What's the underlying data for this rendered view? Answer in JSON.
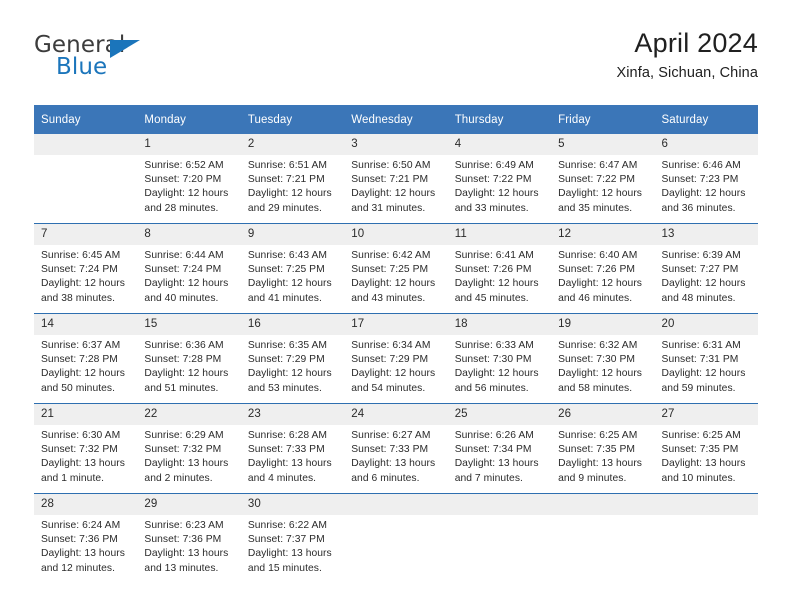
{
  "brand": {
    "name_part1": "General",
    "name_part2": "Blue"
  },
  "header": {
    "title": "April 2024",
    "subtitle": "Xinfa, Sichuan, China"
  },
  "weekday_headers": [
    "Sunday",
    "Monday",
    "Tuesday",
    "Wednesday",
    "Thursday",
    "Friday",
    "Saturday"
  ],
  "colors": {
    "header_blue": "#3b76b8",
    "row_divider_blue": "#2e6fb0",
    "daynum_background": "#efefef",
    "brand_blue": "#1b75bb"
  },
  "weeks": [
    [
      {
        "day": "",
        "empty": true,
        "sunrise": "",
        "sunset": "",
        "daylight1": "",
        "daylight2": ""
      },
      {
        "day": "1",
        "empty": false,
        "sunrise": "Sunrise: 6:52 AM",
        "sunset": "Sunset: 7:20 PM",
        "daylight1": "Daylight: 12 hours",
        "daylight2": "and 28 minutes."
      },
      {
        "day": "2",
        "empty": false,
        "sunrise": "Sunrise: 6:51 AM",
        "sunset": "Sunset: 7:21 PM",
        "daylight1": "Daylight: 12 hours",
        "daylight2": "and 29 minutes."
      },
      {
        "day": "3",
        "empty": false,
        "sunrise": "Sunrise: 6:50 AM",
        "sunset": "Sunset: 7:21 PM",
        "daylight1": "Daylight: 12 hours",
        "daylight2": "and 31 minutes."
      },
      {
        "day": "4",
        "empty": false,
        "sunrise": "Sunrise: 6:49 AM",
        "sunset": "Sunset: 7:22 PM",
        "daylight1": "Daylight: 12 hours",
        "daylight2": "and 33 minutes."
      },
      {
        "day": "5",
        "empty": false,
        "sunrise": "Sunrise: 6:47 AM",
        "sunset": "Sunset: 7:22 PM",
        "daylight1": "Daylight: 12 hours",
        "daylight2": "and 35 minutes."
      },
      {
        "day": "6",
        "empty": false,
        "sunrise": "Sunrise: 6:46 AM",
        "sunset": "Sunset: 7:23 PM",
        "daylight1": "Daylight: 12 hours",
        "daylight2": "and 36 minutes."
      }
    ],
    [
      {
        "day": "7",
        "empty": false,
        "sunrise": "Sunrise: 6:45 AM",
        "sunset": "Sunset: 7:24 PM",
        "daylight1": "Daylight: 12 hours",
        "daylight2": "and 38 minutes."
      },
      {
        "day": "8",
        "empty": false,
        "sunrise": "Sunrise: 6:44 AM",
        "sunset": "Sunset: 7:24 PM",
        "daylight1": "Daylight: 12 hours",
        "daylight2": "and 40 minutes."
      },
      {
        "day": "9",
        "empty": false,
        "sunrise": "Sunrise: 6:43 AM",
        "sunset": "Sunset: 7:25 PM",
        "daylight1": "Daylight: 12 hours",
        "daylight2": "and 41 minutes."
      },
      {
        "day": "10",
        "empty": false,
        "sunrise": "Sunrise: 6:42 AM",
        "sunset": "Sunset: 7:25 PM",
        "daylight1": "Daylight: 12 hours",
        "daylight2": "and 43 minutes."
      },
      {
        "day": "11",
        "empty": false,
        "sunrise": "Sunrise: 6:41 AM",
        "sunset": "Sunset: 7:26 PM",
        "daylight1": "Daylight: 12 hours",
        "daylight2": "and 45 minutes."
      },
      {
        "day": "12",
        "empty": false,
        "sunrise": "Sunrise: 6:40 AM",
        "sunset": "Sunset: 7:26 PM",
        "daylight1": "Daylight: 12 hours",
        "daylight2": "and 46 minutes."
      },
      {
        "day": "13",
        "empty": false,
        "sunrise": "Sunrise: 6:39 AM",
        "sunset": "Sunset: 7:27 PM",
        "daylight1": "Daylight: 12 hours",
        "daylight2": "and 48 minutes."
      }
    ],
    [
      {
        "day": "14",
        "empty": false,
        "sunrise": "Sunrise: 6:37 AM",
        "sunset": "Sunset: 7:28 PM",
        "daylight1": "Daylight: 12 hours",
        "daylight2": "and 50 minutes."
      },
      {
        "day": "15",
        "empty": false,
        "sunrise": "Sunrise: 6:36 AM",
        "sunset": "Sunset: 7:28 PM",
        "daylight1": "Daylight: 12 hours",
        "daylight2": "and 51 minutes."
      },
      {
        "day": "16",
        "empty": false,
        "sunrise": "Sunrise: 6:35 AM",
        "sunset": "Sunset: 7:29 PM",
        "daylight1": "Daylight: 12 hours",
        "daylight2": "and 53 minutes."
      },
      {
        "day": "17",
        "empty": false,
        "sunrise": "Sunrise: 6:34 AM",
        "sunset": "Sunset: 7:29 PM",
        "daylight1": "Daylight: 12 hours",
        "daylight2": "and 54 minutes."
      },
      {
        "day": "18",
        "empty": false,
        "sunrise": "Sunrise: 6:33 AM",
        "sunset": "Sunset: 7:30 PM",
        "daylight1": "Daylight: 12 hours",
        "daylight2": "and 56 minutes."
      },
      {
        "day": "19",
        "empty": false,
        "sunrise": "Sunrise: 6:32 AM",
        "sunset": "Sunset: 7:30 PM",
        "daylight1": "Daylight: 12 hours",
        "daylight2": "and 58 minutes."
      },
      {
        "day": "20",
        "empty": false,
        "sunrise": "Sunrise: 6:31 AM",
        "sunset": "Sunset: 7:31 PM",
        "daylight1": "Daylight: 12 hours",
        "daylight2": "and 59 minutes."
      }
    ],
    [
      {
        "day": "21",
        "empty": false,
        "sunrise": "Sunrise: 6:30 AM",
        "sunset": "Sunset: 7:32 PM",
        "daylight1": "Daylight: 13 hours",
        "daylight2": "and 1 minute."
      },
      {
        "day": "22",
        "empty": false,
        "sunrise": "Sunrise: 6:29 AM",
        "sunset": "Sunset: 7:32 PM",
        "daylight1": "Daylight: 13 hours",
        "daylight2": "and 2 minutes."
      },
      {
        "day": "23",
        "empty": false,
        "sunrise": "Sunrise: 6:28 AM",
        "sunset": "Sunset: 7:33 PM",
        "daylight1": "Daylight: 13 hours",
        "daylight2": "and 4 minutes."
      },
      {
        "day": "24",
        "empty": false,
        "sunrise": "Sunrise: 6:27 AM",
        "sunset": "Sunset: 7:33 PM",
        "daylight1": "Daylight: 13 hours",
        "daylight2": "and 6 minutes."
      },
      {
        "day": "25",
        "empty": false,
        "sunrise": "Sunrise: 6:26 AM",
        "sunset": "Sunset: 7:34 PM",
        "daylight1": "Daylight: 13 hours",
        "daylight2": "and 7 minutes."
      },
      {
        "day": "26",
        "empty": false,
        "sunrise": "Sunrise: 6:25 AM",
        "sunset": "Sunset: 7:35 PM",
        "daylight1": "Daylight: 13 hours",
        "daylight2": "and 9 minutes."
      },
      {
        "day": "27",
        "empty": false,
        "sunrise": "Sunrise: 6:25 AM",
        "sunset": "Sunset: 7:35 PM",
        "daylight1": "Daylight: 13 hours",
        "daylight2": "and 10 minutes."
      }
    ],
    [
      {
        "day": "28",
        "empty": false,
        "sunrise": "Sunrise: 6:24 AM",
        "sunset": "Sunset: 7:36 PM",
        "daylight1": "Daylight: 13 hours",
        "daylight2": "and 12 minutes."
      },
      {
        "day": "29",
        "empty": false,
        "sunrise": "Sunrise: 6:23 AM",
        "sunset": "Sunset: 7:36 PM",
        "daylight1": "Daylight: 13 hours",
        "daylight2": "and 13 minutes."
      },
      {
        "day": "30",
        "empty": false,
        "sunrise": "Sunrise: 6:22 AM",
        "sunset": "Sunset: 7:37 PM",
        "daylight1": "Daylight: 13 hours",
        "daylight2": "and 15 minutes."
      },
      {
        "day": "",
        "empty": true,
        "sunrise": "",
        "sunset": "",
        "daylight1": "",
        "daylight2": ""
      },
      {
        "day": "",
        "empty": true,
        "sunrise": "",
        "sunset": "",
        "daylight1": "",
        "daylight2": ""
      },
      {
        "day": "",
        "empty": true,
        "sunrise": "",
        "sunset": "",
        "daylight1": "",
        "daylight2": ""
      },
      {
        "day": "",
        "empty": true,
        "sunrise": "",
        "sunset": "",
        "daylight1": "",
        "daylight2": ""
      }
    ]
  ]
}
